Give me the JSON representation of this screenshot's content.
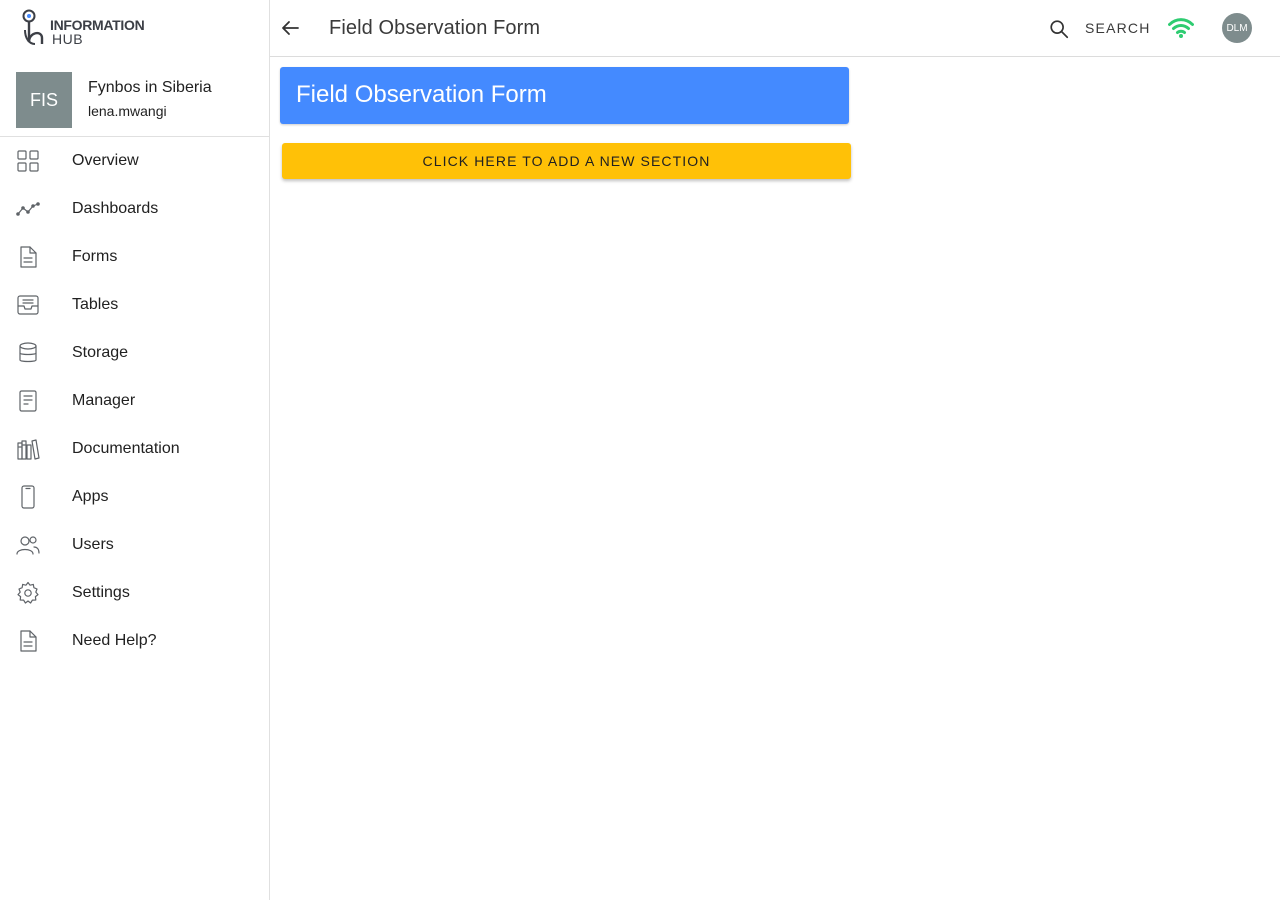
{
  "logo": {
    "line1": "INFORMATION",
    "line2": "HUB"
  },
  "account": {
    "initials": "FIS",
    "name": "Fynbos in Siberia",
    "username": "lena.mwangi",
    "avatar_color": "#7e8c8d"
  },
  "sidebar": {
    "items": [
      {
        "label": "Overview",
        "icon": "grid-icon"
      },
      {
        "label": "Dashboards",
        "icon": "trend-line-icon"
      },
      {
        "label": "Forms",
        "icon": "document-icon"
      },
      {
        "label": "Tables",
        "icon": "inbox-tray-icon"
      },
      {
        "label": "Storage",
        "icon": "database-icon"
      },
      {
        "label": "Manager",
        "icon": "notepad-icon"
      },
      {
        "label": "Documentation",
        "icon": "books-icon"
      },
      {
        "label": "Apps",
        "icon": "mobile-phone-icon"
      },
      {
        "label": "Users",
        "icon": "users-icon"
      },
      {
        "label": "Settings",
        "icon": "gear-icon"
      },
      {
        "label": "Need Help?",
        "icon": "help-document-icon"
      }
    ]
  },
  "topbar": {
    "title": "Field Observation Form",
    "search_label": "SEARCH",
    "user_initials": "DLM",
    "wifi_color": "#2ecc71"
  },
  "main": {
    "form_title": "Field Observation Form",
    "form_header_color": "#448aff",
    "add_section_label": "CLICK HERE TO ADD A NEW SECTION",
    "add_section_color": "#ffc107"
  }
}
